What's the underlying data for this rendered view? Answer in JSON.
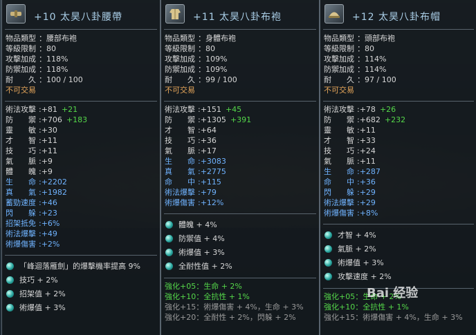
{
  "panels": [
    {
      "title": "+10 太昊八卦腰帶",
      "icon": "belt-icon",
      "basic": [
        {
          "label": "物品類型",
          "value": "腰部布袍"
        },
        {
          "label": "等級限制",
          "value": "80"
        },
        {
          "label": "攻擊加成",
          "value": "118%"
        },
        {
          "label": "防禦加成",
          "value": "118%"
        },
        {
          "label": "耐　　久",
          "value": "100 / 100"
        }
      ],
      "notrade": "不可交易",
      "stats": [
        {
          "label": "術法攻擊",
          "value": "+81",
          "bonus": "+21",
          "color": "w"
        },
        {
          "label": "防　　禦",
          "value": "+706",
          "bonus": "+183",
          "color": "w"
        },
        {
          "label": "靈　　敏",
          "value": "+30",
          "bonus": "",
          "color": "w"
        },
        {
          "label": "才　　智",
          "value": "+11",
          "bonus": "",
          "color": "w"
        },
        {
          "label": "技　　巧",
          "value": "+11",
          "bonus": "",
          "color": "w"
        },
        {
          "label": "氣　　脈",
          "value": "+9",
          "bonus": "",
          "color": "w"
        },
        {
          "label": "體　　魄",
          "value": "+9",
          "bonus": "",
          "color": "w"
        },
        {
          "label": "生　　命",
          "value": "+2202",
          "bonus": "",
          "color": "b"
        },
        {
          "label": "真　　氣",
          "value": "+1982",
          "bonus": "",
          "color": "b"
        },
        {
          "label": "蓄勁速度",
          "value": "+46",
          "bonus": "",
          "color": "b"
        },
        {
          "label": "閃　　躲",
          "value": "+23",
          "bonus": "",
          "color": "b"
        },
        {
          "label": "招架抵免",
          "value": "+6%",
          "bonus": "",
          "color": "b"
        },
        {
          "label": "術法爆擊",
          "value": "+49",
          "bonus": "",
          "color": "b"
        },
        {
          "label": "術爆傷害",
          "value": "+2%",
          "bonus": "",
          "color": "b"
        }
      ],
      "set": [
        "「峰迴落雁劍」的爆擊機率提高 9%",
        "技巧 + 2%",
        "招架值 + 2%",
        "術爆值 + 3%"
      ],
      "enhance": []
    },
    {
      "title": "+11 太昊八卦布袍",
      "icon": "robe-icon",
      "basic": [
        {
          "label": "物品類型",
          "value": "身體布袍"
        },
        {
          "label": "等級限制",
          "value": "80"
        },
        {
          "label": "攻擊加成",
          "value": "109%"
        },
        {
          "label": "防禦加成",
          "value": "109%"
        },
        {
          "label": "耐　　久",
          "value": "99 / 100"
        }
      ],
      "notrade": "不可交易",
      "stats": [
        {
          "label": "術法攻擊",
          "value": "+151",
          "bonus": "+45",
          "color": "w"
        },
        {
          "label": "防　　禦",
          "value": "+1305",
          "bonus": "+391",
          "color": "w"
        },
        {
          "label": "才　　智",
          "value": "+64",
          "bonus": "",
          "color": "w"
        },
        {
          "label": "技　　巧",
          "value": "+36",
          "bonus": "",
          "color": "w"
        },
        {
          "label": "氣　　脈",
          "value": "+17",
          "bonus": "",
          "color": "w"
        },
        {
          "label": "生　　命",
          "value": "+3083",
          "bonus": "",
          "color": "b"
        },
        {
          "label": "真　　氣",
          "value": "+2775",
          "bonus": "",
          "color": "b"
        },
        {
          "label": "命　　中",
          "value": "+115",
          "bonus": "",
          "color": "b"
        },
        {
          "label": "術法爆擊",
          "value": "+79",
          "bonus": "",
          "color": "b"
        },
        {
          "label": "術爆傷害",
          "value": "+12%",
          "bonus": "",
          "color": "b"
        }
      ],
      "set": [
        "體魄 + 4%",
        "防禦值 + 4%",
        "術爆值 + 3%",
        "全耐性值 + 2%"
      ],
      "enhance": [
        {
          "text": "強化+05：生命 + 2%",
          "color": "g"
        },
        {
          "text": "強化+10：全抗性 + 1%",
          "color": "g"
        },
        {
          "text": "強化+15：術爆傷害 + 4%，生命 + 3%",
          "color": "grey"
        },
        {
          "text": "強化+20：全耐性 + 2%，閃躲 + 2%",
          "color": "grey"
        }
      ]
    },
    {
      "title": "+12 太昊八卦布帽",
      "icon": "hat-icon",
      "basic": [
        {
          "label": "物品類型",
          "value": "頭部布袍"
        },
        {
          "label": "等級限制",
          "value": "80"
        },
        {
          "label": "攻擊加成",
          "value": "114%"
        },
        {
          "label": "防禦加成",
          "value": "114%"
        },
        {
          "label": "耐　　久",
          "value": "97 / 100"
        }
      ],
      "notrade": "不可交易",
      "stats": [
        {
          "label": "術法攻擊",
          "value": "+78",
          "bonus": "+26",
          "color": "w"
        },
        {
          "label": "防　　禦",
          "value": "+682",
          "bonus": "+232",
          "color": "w"
        },
        {
          "label": "靈　　敏",
          "value": "+11",
          "bonus": "",
          "color": "w"
        },
        {
          "label": "才　　智",
          "value": "+33",
          "bonus": "",
          "color": "w"
        },
        {
          "label": "技　　巧",
          "value": "+24",
          "bonus": "",
          "color": "w"
        },
        {
          "label": "氣　　脈",
          "value": "+11",
          "bonus": "",
          "color": "w"
        },
        {
          "label": "生　　命",
          "value": "+287",
          "bonus": "",
          "color": "b"
        },
        {
          "label": "命　　中",
          "value": "+36",
          "bonus": "",
          "color": "b"
        },
        {
          "label": "閃　　躲",
          "value": "+29",
          "bonus": "",
          "color": "b"
        },
        {
          "label": "術法爆擊",
          "value": "+29",
          "bonus": "",
          "color": "b"
        },
        {
          "label": "術爆傷害",
          "value": "+8%",
          "bonus": "",
          "color": "b"
        }
      ],
      "set": [
        "才智 + 4%",
        "氣脈 + 2%",
        "術爆值 + 3%",
        "攻擊速度 + 2%"
      ],
      "enhance": [
        {
          "text": "強化+05：生命 + 2%",
          "color": "g"
        },
        {
          "text": "強化+10：全抗性 + 1%",
          "color": "g"
        },
        {
          "text": "強化+15：術爆傷害 + 4%，生命 + 3%",
          "color": "grey"
        }
      ]
    }
  ],
  "watermark": "Bai 经验"
}
